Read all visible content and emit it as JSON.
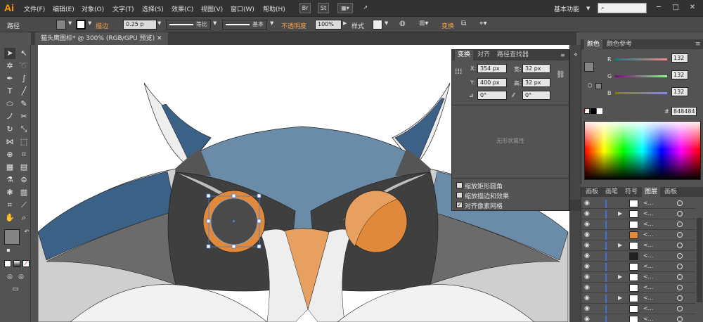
{
  "app": {
    "logo": "Ai",
    "accent": "#ff9a00"
  },
  "menubar": {
    "items": [
      "文件(F)",
      "编辑(E)",
      "对象(O)",
      "文字(T)",
      "选择(S)",
      "效果(C)",
      "视图(V)",
      "窗口(W)",
      "帮助(H)"
    ],
    "bridge_badge": "Br",
    "stock_badge": "St",
    "workspace": "基本功能",
    "search_placeholder": "",
    "win_minimize": "─",
    "win_maximize": "□",
    "win_close": "✕"
  },
  "controlbar": {
    "selection_type": "路径",
    "stroke_label": "描边",
    "stroke_value": "0.25 p",
    "stroke_profile": "等比",
    "brush": "基本",
    "opacity_label": "不透明度",
    "opacity_value": "100%",
    "style_label": "样式",
    "transform_label": "变换"
  },
  "document": {
    "tab_title": "猫头鹰图标* @ 300% (RGB/GPU 预览)",
    "close_glyph": "✕"
  },
  "transform_panel": {
    "tabs": [
      "变换",
      "对齐",
      "路径查找器"
    ],
    "x_label": "X:",
    "x_value": "354 px",
    "y_label": "Y:",
    "y_value": "400 px",
    "w_label": "宽:",
    "w_value": "32 px",
    "h_label": "高:",
    "h_value": "32 px",
    "rotate_value": "0°",
    "shear_value": "0°",
    "no_shape_props": "无形状属性",
    "options": [
      {
        "label": "缩放矩形圆角",
        "checked": false
      },
      {
        "label": "缩放描边和效果",
        "checked": false
      },
      {
        "label": "对齐像素网格",
        "checked": true
      }
    ]
  },
  "color_panel": {
    "tabs": [
      "颜色",
      "颜色参考"
    ],
    "r_label": "R",
    "r_value": "132",
    "g_label": "G",
    "g_value": "132",
    "b_label": "B",
    "b_value": "132",
    "hex_label": "#",
    "hex_value": "848484"
  },
  "layers_panel": {
    "tabs": [
      "画板",
      "画笔",
      "符号",
      "图层",
      "画板"
    ],
    "active_tab": "图层",
    "row_label": "<..."
  },
  "colors": {
    "owl_blue": "#6a8ca8",
    "owl_dark_blue": "#3b6186",
    "owl_dark": "#3f3f3f",
    "owl_gray": "#6b6b6b",
    "owl_light": "#cfcfcf",
    "owl_orange": "#e0893a",
    "beak": "#e8a060"
  }
}
